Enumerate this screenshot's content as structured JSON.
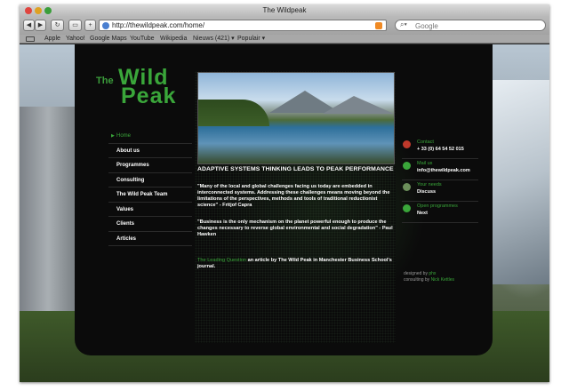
{
  "window": {
    "title": "The Wildpeak"
  },
  "toolbar": {
    "back_icon": "back-arrow-icon",
    "forward_icon": "forward-arrow-icon",
    "reload_icon": "reload-icon",
    "url": "http://thewildpeak.com/home/",
    "search_placeholder": "Google"
  },
  "bookmarks": {
    "items": [
      "Apple",
      "Yahoo!",
      "Google Maps",
      "YouTube",
      "Wikipedia",
      "Nieuws (421) ▾",
      "Populair ▾"
    ]
  },
  "logo": {
    "the": "The",
    "wild": "Wild",
    "peak": "Peak"
  },
  "nav": {
    "items": [
      "Home",
      "About us",
      "Programmes",
      "Consulting",
      "The Wild Peak Team",
      "Values",
      "Clients",
      "Articles"
    ]
  },
  "main": {
    "headline": "ADAPTIVE SYSTEMS THINKING LEADS TO PEAK PERFORMANCE",
    "quote1": "\"Many of the local and global challenges facing us today are embedded in interconnected systems. Addressing these challenges means moving beyond the limitations of the perspectives, methods and tools of traditional reductionist science\" - Fritjof Capra",
    "quote2": "\"Business is the only mechanism on the planet powerful enough to produce the changes necessary to reverse global environmental and social degradation\" - Paul Hawken",
    "article_link": "The Leading Question",
    "article_text": " an article by The Wild Peak in Manchester Business School's journal."
  },
  "contacts": [
    {
      "label": "Contact",
      "value": "+ 33 (0) 64 54 52 015",
      "color": "#c0392b"
    },
    {
      "label": "Mail us",
      "value": "info@thewildpeak.com",
      "color": "#3aa63a"
    },
    {
      "label": "Your needs",
      "value": "Discuss",
      "color": "#6b8f5a"
    },
    {
      "label": "Open programmes",
      "value": "Next",
      "color": "#3aa63a"
    }
  ],
  "credits": {
    "designed_by": "designed by",
    "designer": "phx",
    "consulting_by": "consulting by",
    "consultant": "Nick Kettles"
  }
}
